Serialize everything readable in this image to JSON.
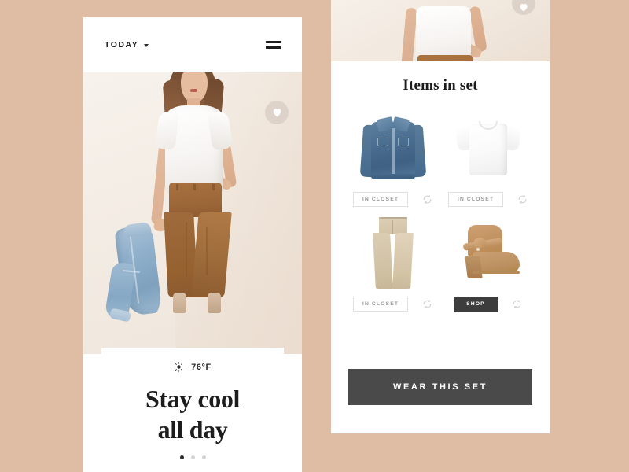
{
  "theme": {
    "page_background": "#dfbda4",
    "card_background": "#ffffff",
    "text_dark": "#1c1c1c",
    "muted_text": "#9a9a9a",
    "shop_button_bg": "#3d3d3d",
    "wear_button_bg": "#4a4a4a",
    "border_light": "#e0e0e0"
  },
  "screen_today": {
    "header": {
      "title": "TODAY",
      "dropdown_icon": "chevron-down-icon",
      "menu_icon": "hamburger-menu-icon"
    },
    "hero": {
      "favorite_icon": "heart-icon",
      "image_alt": "model-wearing-white-tee-brown-wide-leg-pants-holding-denim-jacket"
    },
    "weather": {
      "condition_icon": "sun-icon",
      "temperature": "76°F"
    },
    "headline": {
      "line1": "Stay cool",
      "line2": "all day"
    },
    "pagination": {
      "total": 3,
      "active_index": 0
    }
  },
  "screen_set": {
    "hero": {
      "favorite_icon": "heart-icon",
      "image_alt": "cropped-model-white-tee-brown-pants"
    },
    "title": "Items in set",
    "items": [
      {
        "name": "denim-jacket",
        "action_label": "IN CLOSET",
        "action_style": "outline",
        "swap_icon": "refresh-swap-icon"
      },
      {
        "name": "white-tee",
        "action_label": "IN CLOSET",
        "action_style": "outline",
        "swap_icon": "refresh-swap-icon"
      },
      {
        "name": "wide-leg-trousers",
        "action_label": "IN CLOSET",
        "action_style": "outline",
        "swap_icon": "refresh-swap-icon"
      },
      {
        "name": "suede-ankle-boot",
        "action_label": "SHOP",
        "action_style": "filled",
        "swap_icon": "refresh-swap-icon"
      }
    ],
    "primary_action": "WEAR THIS SET"
  }
}
